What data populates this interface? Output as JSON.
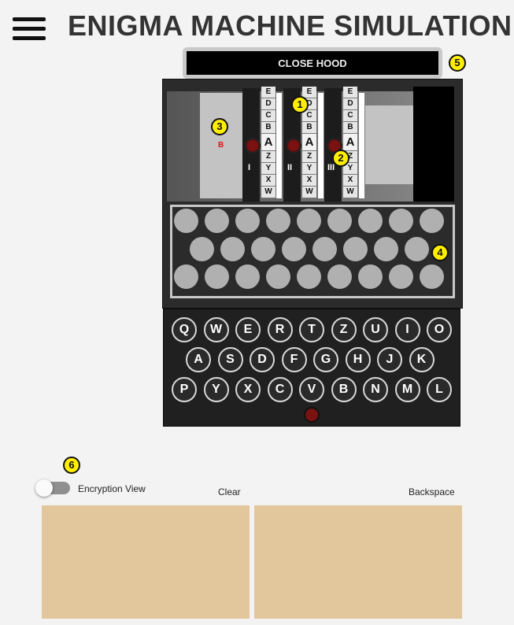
{
  "header": {
    "title": "ENIGMA MACHINE SIMULATION",
    "menu_icon": "hamburger-menu-icon"
  },
  "hood": {
    "button_label": "CLOSE HOOD"
  },
  "badges": [
    "1",
    "2",
    "3",
    "4",
    "5",
    "6"
  ],
  "rotors": [
    {
      "numeral": "I",
      "current": "A",
      "above": [
        "E",
        "D",
        "C",
        "B"
      ],
      "below": [
        "Z",
        "Y",
        "X",
        "W"
      ]
    },
    {
      "numeral": "II",
      "current": "A",
      "above": [
        "E",
        "D",
        "C",
        "B"
      ],
      "below": [
        "Z",
        "Y",
        "X",
        "W"
      ]
    },
    {
      "numeral": "III",
      "current": "A",
      "above": [
        "E",
        "D",
        "C",
        "B"
      ],
      "below": [
        "Z",
        "Y",
        "X",
        "W"
      ]
    }
  ],
  "reflector_letter": "B",
  "keyboard": {
    "rows": [
      [
        "Q",
        "W",
        "E",
        "R",
        "T",
        "Z",
        "U",
        "I",
        "O"
      ],
      [
        "A",
        "S",
        "D",
        "F",
        "G",
        "H",
        "J",
        "K"
      ],
      [
        "P",
        "Y",
        "X",
        "C",
        "V",
        "B",
        "N",
        "M",
        "L"
      ]
    ]
  },
  "encryption": {
    "toggle_label": "Encryption View",
    "toggle_on": false,
    "clear_label": "Clear",
    "backspace_label": "Backspace",
    "input_text": "",
    "output_text": ""
  },
  "colors": {
    "badge": "#ffee00",
    "text_box": "#e2c79c",
    "knob": "#7a1212",
    "reflector_letter": "#e01010"
  }
}
